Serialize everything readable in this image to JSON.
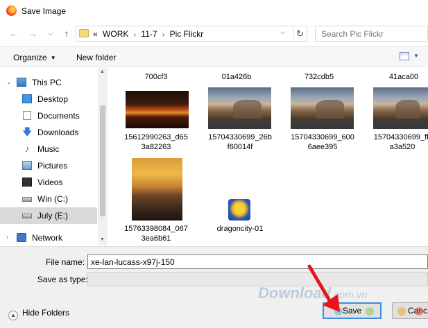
{
  "window": {
    "title": "Save Image",
    "icon": "firefox-icon"
  },
  "nav": {
    "back_icon": "arrow-left-icon",
    "forward_icon": "arrow-right-icon",
    "recent_icon": "chevron-down-icon",
    "up_icon": "arrow-up-icon"
  },
  "address": {
    "prefix": "«",
    "crumbs": [
      "WORK",
      "11-7",
      "Pic Flickr"
    ],
    "separator": "›",
    "refresh_icon": "refresh-icon"
  },
  "search": {
    "placeholder": "Search Pic Flickr"
  },
  "toolbar": {
    "organize_label": "Organize",
    "new_folder_label": "New folder",
    "view_icon": "view-options-icon"
  },
  "sidebar": {
    "items": [
      {
        "label": "This PC",
        "icon": "computer-icon"
      },
      {
        "label": "Desktop",
        "icon": "desktop-icon"
      },
      {
        "label": "Documents",
        "icon": "documents-icon"
      },
      {
        "label": "Downloads",
        "icon": "downloads-icon"
      },
      {
        "label": "Music",
        "icon": "music-icon"
      },
      {
        "label": "Pictures",
        "icon": "pictures-icon"
      },
      {
        "label": "Videos",
        "icon": "videos-icon"
      },
      {
        "label": "Win (C:)",
        "icon": "drive-icon"
      },
      {
        "label": "July (E:)",
        "icon": "drive-icon",
        "selected": true
      },
      {
        "label": "Network",
        "icon": "network-icon"
      }
    ]
  },
  "files": {
    "top_row_partial": [
      "700cf3",
      "01a426b",
      "732cdb5",
      "41aca00"
    ],
    "row1": [
      {
        "name": "15612990263_d65\n3a82263",
        "thumb": "sunset-thumbnail"
      },
      {
        "name": "15704330699_26b\nf60014f",
        "thumb": "coast-thumbnail"
      },
      {
        "name": "15704330699_600\n6aee395",
        "thumb": "coast-thumbnail"
      },
      {
        "name": "15704330699_fb\na3a520",
        "thumb": "coast-thumbnail"
      }
    ],
    "row2": [
      {
        "name": "15763398084_067\n3ea6b61",
        "thumb": "beach-thumbnail"
      },
      {
        "name": "dragoncity-01",
        "thumb": "dragon-thumbnail"
      }
    ]
  },
  "form": {
    "file_name_label": "File name:",
    "file_name_value": "xe-lan-lucass-x97j-150",
    "save_as_type_label": "Save as type:",
    "save_as_type_value": ""
  },
  "footer": {
    "hide_folders_label": "Hide Folders",
    "save_label": "Save",
    "cancel_label": "Canc"
  },
  "watermark": {
    "text": "Download",
    "suffix": ".com.vn"
  },
  "colors": {
    "accent": "#3c8ddb",
    "arrow": "#e8141b",
    "selected": "#d9d9d9"
  }
}
